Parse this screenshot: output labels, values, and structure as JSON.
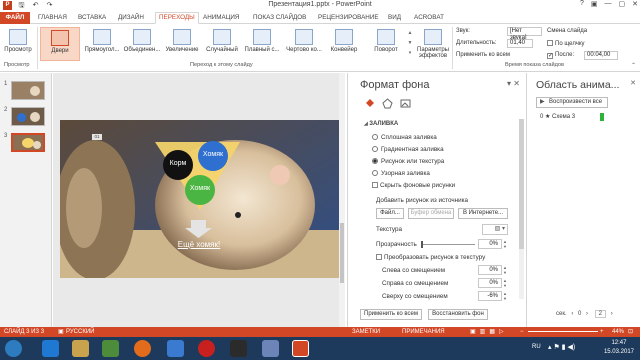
{
  "window": {
    "title": "Презентация1.pptx - PowerPoint",
    "controls": [
      "?",
      "▣",
      "—",
      "▢",
      "✕"
    ]
  },
  "qat": [
    "↶",
    "↷",
    "🖫"
  ],
  "tabs": {
    "file": "ФАЙЛ",
    "items": [
      "ГЛАВНАЯ",
      "ВСТАВКА",
      "ДИЗАЙН",
      "ПЕРЕХОДЫ",
      "АНИМАЦИЯ",
      "ПОКАЗ СЛАЙДОВ",
      "РЕЦЕНЗИРОВАНИЕ",
      "ВИД",
      "ACROBAT"
    ],
    "active_index": 3
  },
  "ribbon": {
    "preview_label": "Просмотр",
    "preview_group": "Просмотр",
    "transitions": [
      "Двери",
      "Прямоугол...",
      "Объединен...",
      "Увеличение",
      "Случайный",
      "Плавный с...",
      "Чертово ко...",
      "Конвейер",
      "Поворот"
    ],
    "transitions_group": "Переход к этому слайду",
    "effects_label": "Параметры эффектов",
    "sound_label": "Звук:",
    "sound_value": "[Нет звука]",
    "duration_label": "Длительность:",
    "duration_value": "01,40",
    "apply_all": "Применить ко всем",
    "advance_label": "Смена слайда",
    "on_click": "По щелчку",
    "after_label": "После:",
    "after_value": "00:04,00",
    "timing_group": "Время показа слайдов"
  },
  "thumbnails": [
    "1",
    "2",
    "3"
  ],
  "slide": {
    "bubble1": "Корм",
    "bubble2": "Хомяк",
    "bubble3": "Хомяк",
    "caption": "Ещё хомяк!",
    "tag": "01"
  },
  "format_pane": {
    "title": "Формат фона",
    "section": "ЗАЛИВКА",
    "options": [
      {
        "label": "Сплошная заливка",
        "selected": false
      },
      {
        "label": "Градиентная заливка",
        "selected": false
      },
      {
        "label": "Рисунок или текстура",
        "selected": true
      },
      {
        "label": "Узорная заливка",
        "selected": false
      }
    ],
    "hide_bg": "Скрыть фоновые рисунки",
    "insert_from": "Добавить рисунок из источника",
    "btn_file": "Файл...",
    "btn_clipboard": "Буфер обмена",
    "btn_internet": "В Интернете...",
    "texture_label": "Текстура",
    "transparency_label": "Прозрачность",
    "transparency_value": "0%",
    "tile_label": "Преобразовать рисунок в текстуру",
    "left_offset_label": "Слева со смещением",
    "left_offset_value": "0%",
    "right_offset_label": "Справа со смещением",
    "right_offset_value": "0%",
    "top_offset_label": "Сверху со смещением",
    "top_offset_value": "-6%",
    "apply_all_btn": "Применить ко всем",
    "reset_btn": "Восстановить фон"
  },
  "anim_pane": {
    "title": "Область анима...",
    "play_btn": "Воспроизвести все",
    "item": "0 ★ Схема 3",
    "sec_label": "сек.",
    "sec_value": "0",
    "page_value": "2"
  },
  "status": {
    "slide": "СЛАЙД 3 ИЗ 3",
    "lang": "РУССКИЙ",
    "comments": "ЗАМЕТКИ",
    "notes": "ПРИМЕЧАНИЯ",
    "zoom": "44%"
  },
  "taskbar": {
    "lang": "RU",
    "time": "12:47",
    "date": "15.03.2017"
  },
  "colors": {
    "accent": "#d24726",
    "taskbar": "#1d3a5c"
  }
}
